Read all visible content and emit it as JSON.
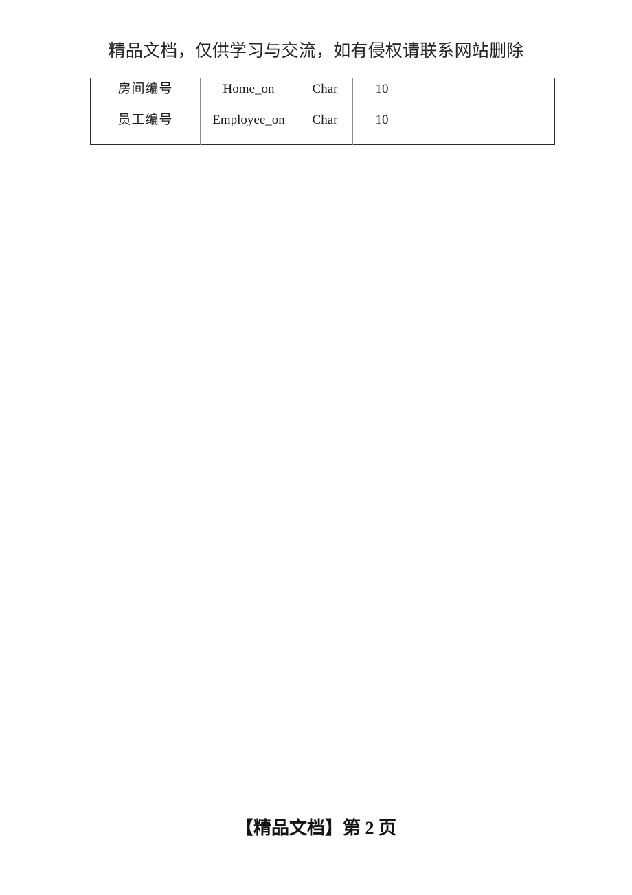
{
  "document": {
    "header_notice": "精品文档，仅供学习与交流，如有侵权请联系网站删除",
    "footer_text": "【精品文档】第 2 页",
    "footer_label": "【精品文档】",
    "page_prefix": "第",
    "page_number": "2",
    "page_suffix": "页",
    "background_color": "#ffffff",
    "text_color": "#000000"
  },
  "table": {
    "border_color": "#2b2b2b",
    "inner_line_color": "#8a8a8a",
    "column_count": 5,
    "row_count": 2,
    "rows": [
      {
        "name_cn": "房间编号",
        "field": "Home_on",
        "type": "Char",
        "length": "10",
        "remark": ""
      },
      {
        "name_cn": "员工编号",
        "field": "Employee_on",
        "type": "Char",
        "length": "10",
        "remark": ""
      }
    ]
  }
}
